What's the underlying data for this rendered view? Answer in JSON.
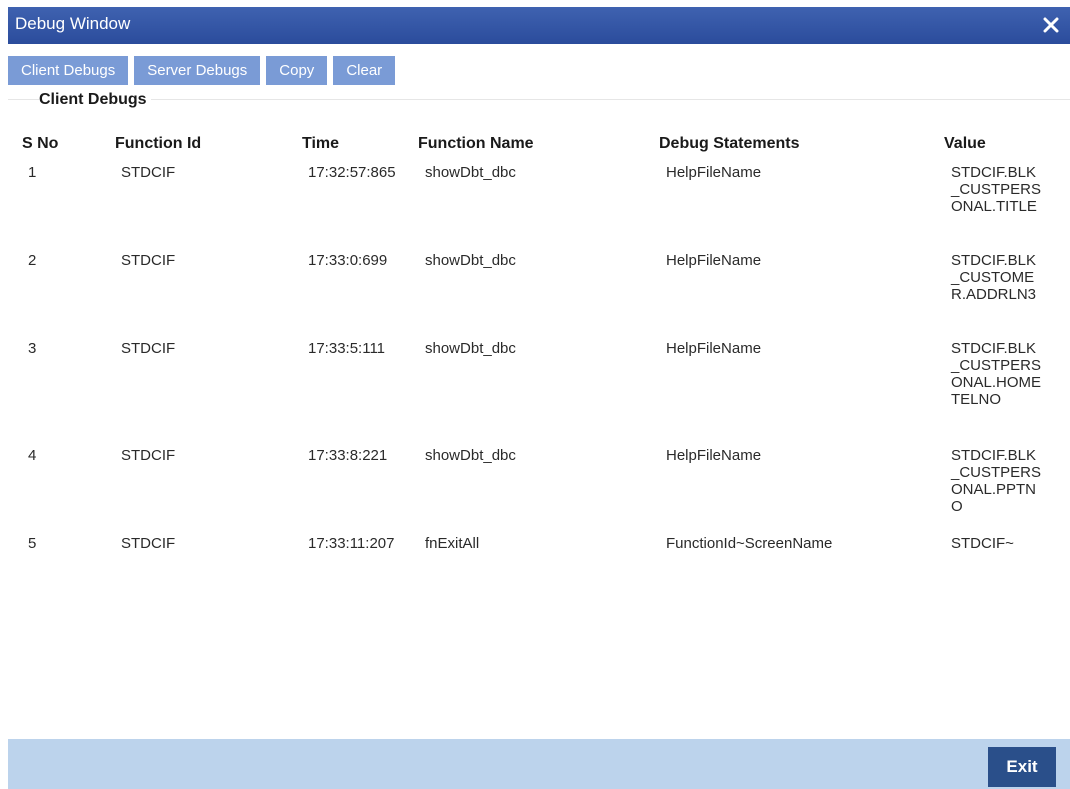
{
  "window": {
    "title": "Debug Window",
    "close_icon": "close-icon"
  },
  "toolbar": {
    "client_debugs": "Client Debugs",
    "server_debugs": "Server Debugs",
    "copy": "Copy",
    "clear": "Clear"
  },
  "section": {
    "title": "Client Debugs"
  },
  "table": {
    "headers": {
      "sno": "S No",
      "function_id": "Function Id",
      "time": "Time",
      "function_name": "Function Name",
      "debug_statements": "Debug Statements",
      "value": "Value"
    },
    "rows": [
      {
        "sno": "1",
        "function_id": "STDCIF",
        "time": "17:32:57:865",
        "function_name": "showDbt_dbc",
        "debug_statements": "HelpFileName",
        "value": "STDCIF.BLK_CUSTPERSONAL.TITLE"
      },
      {
        "sno": "2",
        "function_id": "STDCIF",
        "time": "17:33:0:699",
        "function_name": "showDbt_dbc",
        "debug_statements": "HelpFileName",
        "value": "STDCIF.BLK_CUSTOMER.ADDRLN3"
      },
      {
        "sno": "3",
        "function_id": "STDCIF",
        "time": "17:33:5:111",
        "function_name": "showDbt_dbc",
        "debug_statements": "HelpFileName",
        "value": "STDCIF.BLK_CUSTPERSONAL.HOMETELNO"
      },
      {
        "sno": "4",
        "function_id": "STDCIF",
        "time": "17:33:8:221",
        "function_name": "showDbt_dbc",
        "debug_statements": "HelpFileName",
        "value": "STDCIF.BLK_CUSTPERSONAL.PPTNO"
      },
      {
        "sno": "5",
        "function_id": "STDCIF",
        "time": "17:33:11:207",
        "function_name": "fnExitAll",
        "debug_statements": "FunctionId~ScreenName",
        "value": "STDCIF~"
      }
    ]
  },
  "footer": {
    "exit": "Exit"
  },
  "colors": {
    "titlebar": "#2b4c9c",
    "toolbar_button": "#7a9bd6",
    "footer": "#bcd3ec",
    "exit_button": "#2a4f8a"
  }
}
